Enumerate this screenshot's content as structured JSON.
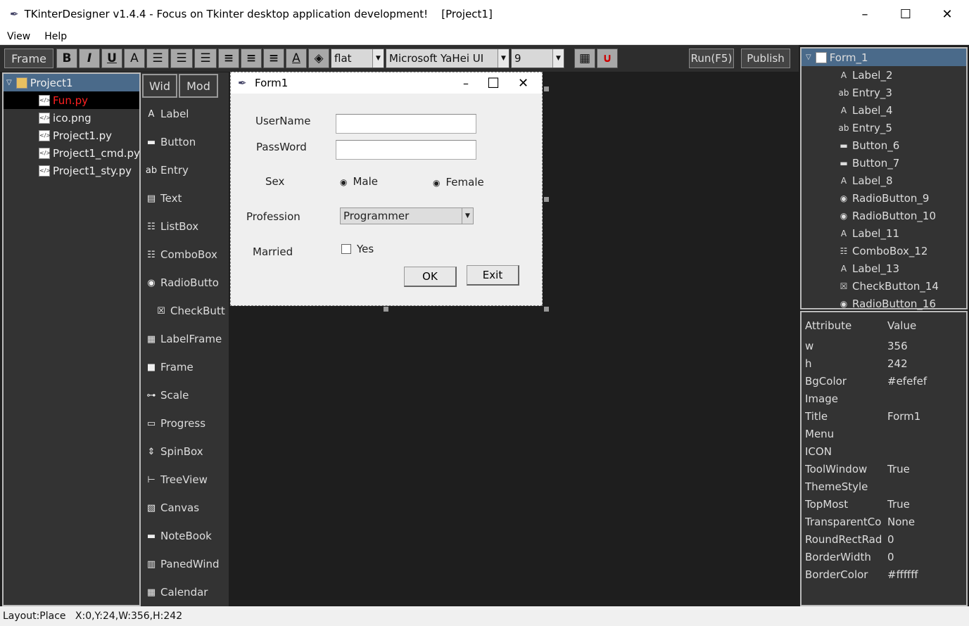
{
  "window": {
    "title": "TKinterDesigner v1.4.4 - Focus on Tkinter desktop application development!    [Project1]",
    "minimize": "–",
    "maximize": "☐",
    "close": "✕"
  },
  "menu": [
    "View",
    "Help"
  ],
  "toolbar": {
    "frame": "Frame",
    "bold": "B",
    "italic": "I",
    "underline": "U",
    "font_a": "A",
    "relief": "flat",
    "font": "Microsoft YaHei UI",
    "size": "9",
    "run": "Run(F5)",
    "publish": "Publish"
  },
  "project_tree": {
    "root": "Project1",
    "items": [
      {
        "name": "Fun.py",
        "selected": true
      },
      {
        "name": "ico.png"
      },
      {
        "name": "Project1.py"
      },
      {
        "name": "Project1_cmd.py"
      },
      {
        "name": "Project1_sty.py"
      }
    ]
  },
  "widget_tabs": [
    "Wid",
    "Mod"
  ],
  "widgets": [
    {
      "label": "Label",
      "icon": "A"
    },
    {
      "label": "Button",
      "icon": "▬"
    },
    {
      "label": "Entry",
      "icon": "ab"
    },
    {
      "label": "Text",
      "icon": "▤"
    },
    {
      "label": "ListBox",
      "icon": "☷"
    },
    {
      "label": "ComboBox",
      "icon": "☷"
    },
    {
      "label": "RadioButto",
      "icon": "◉"
    },
    {
      "label": "CheckButt",
      "icon": "☒"
    },
    {
      "label": "LabelFrame",
      "icon": "▦"
    },
    {
      "label": "Frame",
      "icon": "■"
    },
    {
      "label": "Scale",
      "icon": "⊶"
    },
    {
      "label": "Progress",
      "icon": "▭"
    },
    {
      "label": "SpinBox",
      "icon": "⇕"
    },
    {
      "label": "TreeView",
      "icon": "⊢"
    },
    {
      "label": "Canvas",
      "icon": "▧"
    },
    {
      "label": "NoteBook",
      "icon": "▬"
    },
    {
      "label": "PanedWind",
      "icon": "▥"
    },
    {
      "label": "Calendar",
      "icon": "▦"
    }
  ],
  "form": {
    "title": "Form1",
    "username_label": "UserName",
    "password_label": "PassWord",
    "sex_label": "Sex",
    "male": "Male",
    "female": "Female",
    "profession_label": "Profession",
    "profession_value": "Programmer",
    "married_label": "Married",
    "yes": "Yes",
    "ok": "OK",
    "exit": "Exit"
  },
  "control_tree": {
    "root": "Form_1",
    "items": [
      {
        "name": "Label_2",
        "icon": "A"
      },
      {
        "name": "Entry_3",
        "icon": "ab"
      },
      {
        "name": "Label_4",
        "icon": "A"
      },
      {
        "name": "Entry_5",
        "icon": "ab"
      },
      {
        "name": "Button_6",
        "icon": "▬"
      },
      {
        "name": "Button_7",
        "icon": "▬"
      },
      {
        "name": "Label_8",
        "icon": "A"
      },
      {
        "name": "RadioButton_9",
        "icon": "◉"
      },
      {
        "name": "RadioButton_10",
        "icon": "◉"
      },
      {
        "name": "Label_11",
        "icon": "A"
      },
      {
        "name": "ComboBox_12",
        "icon": "☷"
      },
      {
        "name": "Label_13",
        "icon": "A"
      },
      {
        "name": "CheckButton_14",
        "icon": "☒"
      },
      {
        "name": "RadioButton_16",
        "icon": "◉"
      }
    ]
  },
  "properties": {
    "header": [
      "Attribute",
      "Value"
    ],
    "rows": [
      [
        "w",
        "356"
      ],
      [
        "h",
        "242"
      ],
      [
        "BgColor",
        "#efefef"
      ],
      [
        "Image",
        ""
      ],
      [
        "Title",
        "Form1"
      ],
      [
        "Menu",
        ""
      ],
      [
        "ICON",
        ""
      ],
      [
        "ToolWindow",
        "True"
      ],
      [
        "ThemeStyle",
        ""
      ],
      [
        "TopMost",
        "True"
      ],
      [
        "TransparentCo",
        "None"
      ],
      [
        "RoundRectRad",
        "0"
      ],
      [
        "BorderWidth",
        "0"
      ],
      [
        "BorderColor",
        "#ffffff"
      ]
    ]
  },
  "status": "Layout:Place   X:0,Y:24,W:356,H:242"
}
